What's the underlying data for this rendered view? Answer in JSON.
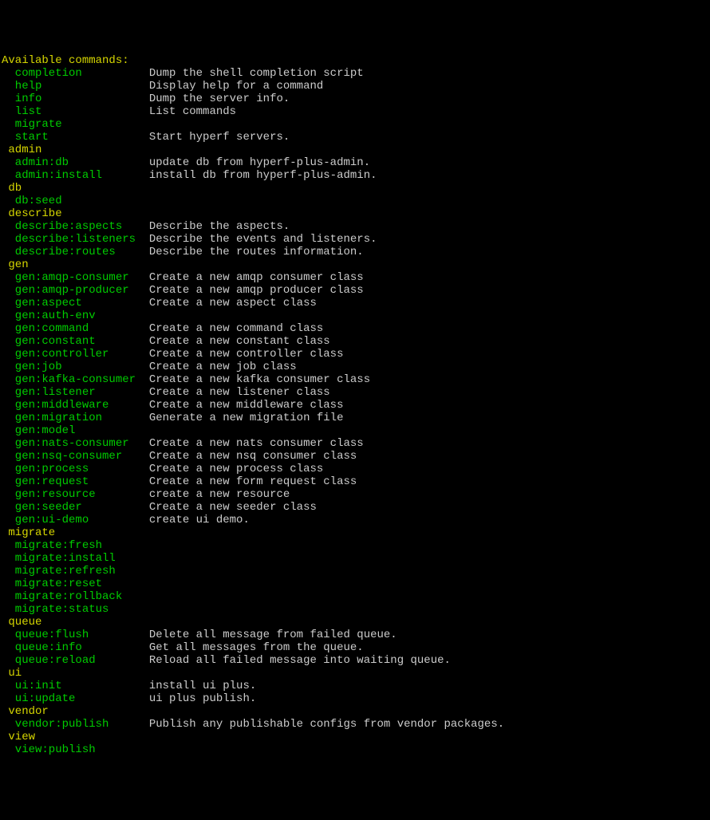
{
  "header": "Available commands:",
  "sections": [
    {
      "name": null,
      "items": [
        {
          "cmd": "completion",
          "desc": "Dump the shell completion script"
        },
        {
          "cmd": "help",
          "desc": "Display help for a command"
        },
        {
          "cmd": "info",
          "desc": "Dump the server info."
        },
        {
          "cmd": "list",
          "desc": "List commands"
        },
        {
          "cmd": "migrate",
          "desc": ""
        },
        {
          "cmd": "start",
          "desc": "Start hyperf servers."
        }
      ]
    },
    {
      "name": "admin",
      "items": [
        {
          "cmd": "admin:db",
          "desc": "update db from hyperf-plus-admin."
        },
        {
          "cmd": "admin:install",
          "desc": "install db from hyperf-plus-admin."
        }
      ]
    },
    {
      "name": "db",
      "items": [
        {
          "cmd": "db:seed",
          "desc": ""
        }
      ]
    },
    {
      "name": "describe",
      "items": [
        {
          "cmd": "describe:aspects",
          "desc": "Describe the aspects."
        },
        {
          "cmd": "describe:listeners",
          "desc": "Describe the events and listeners."
        },
        {
          "cmd": "describe:routes",
          "desc": "Describe the routes information."
        }
      ]
    },
    {
      "name": "gen",
      "items": [
        {
          "cmd": "gen:amqp-consumer",
          "desc": "Create a new amqp consumer class"
        },
        {
          "cmd": "gen:amqp-producer",
          "desc": "Create a new amqp producer class"
        },
        {
          "cmd": "gen:aspect",
          "desc": "Create a new aspect class"
        },
        {
          "cmd": "gen:auth-env",
          "desc": ""
        },
        {
          "cmd": "gen:command",
          "desc": "Create a new command class"
        },
        {
          "cmd": "gen:constant",
          "desc": "Create a new constant class"
        },
        {
          "cmd": "gen:controller",
          "desc": "Create a new controller class"
        },
        {
          "cmd": "gen:job",
          "desc": "Create a new job class"
        },
        {
          "cmd": "gen:kafka-consumer",
          "desc": "Create a new kafka consumer class"
        },
        {
          "cmd": "gen:listener",
          "desc": "Create a new listener class"
        },
        {
          "cmd": "gen:middleware",
          "desc": "Create a new middleware class"
        },
        {
          "cmd": "gen:migration",
          "desc": "Generate a new migration file"
        },
        {
          "cmd": "gen:model",
          "desc": ""
        },
        {
          "cmd": "gen:nats-consumer",
          "desc": "Create a new nats consumer class"
        },
        {
          "cmd": "gen:nsq-consumer",
          "desc": "Create a new nsq consumer class"
        },
        {
          "cmd": "gen:process",
          "desc": "Create a new process class"
        },
        {
          "cmd": "gen:request",
          "desc": "Create a new form request class"
        },
        {
          "cmd": "gen:resource",
          "desc": "create a new resource"
        },
        {
          "cmd": "gen:seeder",
          "desc": "Create a new seeder class"
        },
        {
          "cmd": "gen:ui-demo",
          "desc": "create ui demo."
        }
      ]
    },
    {
      "name": "migrate",
      "items": [
        {
          "cmd": "migrate:fresh",
          "desc": ""
        },
        {
          "cmd": "migrate:install",
          "desc": ""
        },
        {
          "cmd": "migrate:refresh",
          "desc": ""
        },
        {
          "cmd": "migrate:reset",
          "desc": ""
        },
        {
          "cmd": "migrate:rollback",
          "desc": ""
        },
        {
          "cmd": "migrate:status",
          "desc": ""
        }
      ]
    },
    {
      "name": "queue",
      "items": [
        {
          "cmd": "queue:flush",
          "desc": "Delete all message from failed queue."
        },
        {
          "cmd": "queue:info",
          "desc": "Get all messages from the queue."
        },
        {
          "cmd": "queue:reload",
          "desc": "Reload all failed message into waiting queue."
        }
      ]
    },
    {
      "name": "ui",
      "items": [
        {
          "cmd": "ui:init",
          "desc": "install ui plus."
        },
        {
          "cmd": "ui:update",
          "desc": "ui plus publish."
        }
      ]
    },
    {
      "name": "vendor",
      "items": [
        {
          "cmd": "vendor:publish",
          "desc": "Publish any publishable configs from vendor packages."
        }
      ]
    },
    {
      "name": "view",
      "items": [
        {
          "cmd": "view:publish",
          "desc": ""
        }
      ]
    }
  ]
}
